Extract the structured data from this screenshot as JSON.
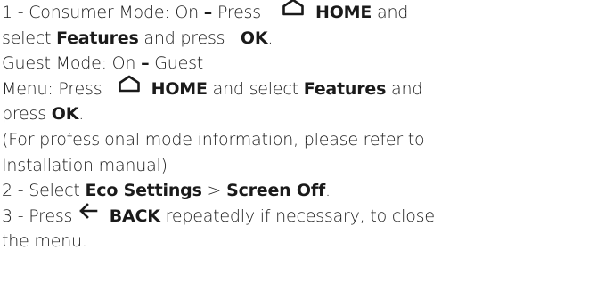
{
  "steps": {
    "l1_a": "1 -  Consumer Mode: On ",
    "l1_dash": "–",
    "l1_b": " Press ",
    "l1_home": "HOME",
    "l1_c": " and",
    "l2_a": "select ",
    "l2_features": "Features",
    "l2_b": "  and press ",
    "l2_ok": "OK",
    "l2_c": ".",
    "l3_a": "Guest Mode: On ",
    "l3_dash": "–",
    "l3_b": " Guest",
    "l4_a": "Menu: Press ",
    "l4_home": "HOME",
    "l4_b": " and select ",
    "l4_features": "Features",
    "l4_c": "  and",
    "l5_a": "press ",
    "l5_ok": "OK",
    "l5_b": ".",
    "l6": "(For professional mode information, please refer to",
    "l7": "Installation manual)",
    "l8_a": "2 -  Select ",
    "l8_eco": "Eco Settings",
    "l8_b": " >   ",
    "l8_screen": "Screen Off",
    "l8_c": ".",
    "l9_a": "3 -  Press ",
    "l9_back": "BACK",
    "l9_b": " repeatedly if necessary, to close",
    "l10": "the menu."
  },
  "icons": {
    "home": "home-icon",
    "back": "arrow-left-icon"
  }
}
